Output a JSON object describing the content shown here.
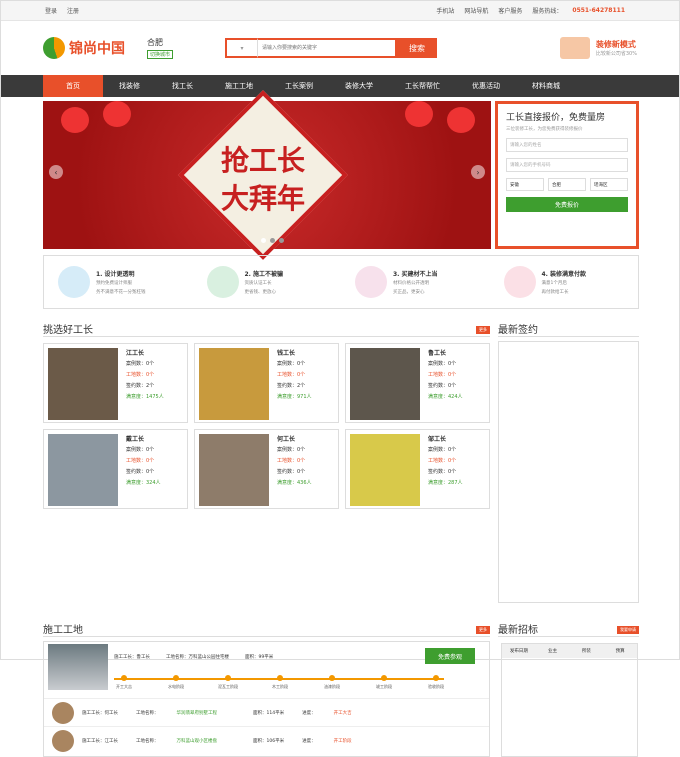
{
  "topbar": {
    "login": "登录",
    "register": "注册",
    "mobile": "手机站",
    "map": "网站导航",
    "service": "客户服务",
    "hotline_label": "服务热线：",
    "hotline": "0551-64278111"
  },
  "header": {
    "logo": "锦尚中国",
    "city": "合肥",
    "switch_city": "切换城市",
    "search_placeholder": "请输入你要搜索的关键字",
    "search_btn": "搜索",
    "promo_title": "装修新模式",
    "promo_sub": "比较新公司省30%"
  },
  "nav": [
    "首页",
    "找装修",
    "找工长",
    "施工工地",
    "工长案例",
    "装修大学",
    "工长帮帮忙",
    "优惠活动",
    "材料商城"
  ],
  "banner": {
    "line1": "抢工长",
    "line2": "大拜年"
  },
  "quote": {
    "title": "工长直接报价，免费量房",
    "sub": "三位装修工长，为您免费获得装修报价",
    "name": "请输入您的姓名",
    "phone": "请输入您的手机号码",
    "prov": "安徽",
    "city": "合肥",
    "area": "瑶海区",
    "btn": "免费报价"
  },
  "features": [
    {
      "title": "1. 设计更透明",
      "d1": "预约免费设计师服",
      "d2": "务不满意不花一分冤枉钱"
    },
    {
      "title": "2. 施工不被骗",
      "d1": "资质认证工长",
      "d2": "更省钱、更放心"
    },
    {
      "title": "3. 买建材不上当",
      "d1": "材料价格公开透明",
      "d2": "买正品，更安心"
    },
    {
      "title": "4. 装修满意付款",
      "d1": "满意1个月后",
      "d2": "再付款给工长"
    }
  ],
  "sections": {
    "good": "挑选好工长",
    "good_more": "更多",
    "latest_sign": "最新签约",
    "site": "施工工地",
    "site_more": "更多",
    "latest_bid": "最新招标",
    "bid_more": "我要申请"
  },
  "workers": [
    {
      "name": "江工长",
      "cases": "案例数：0个",
      "sites": "工地数：0个",
      "sign": "签约数：2个",
      "score": "满意度：1475人"
    },
    {
      "name": "钱工长",
      "cases": "案例数：0个",
      "sites": "工地数：0个",
      "sign": "签约数：2个",
      "score": "满意度：971人"
    },
    {
      "name": "鲁工长",
      "cases": "案例数：0个",
      "sites": "工地数：0个",
      "sign": "签约数：0个",
      "score": "满意度：424人"
    },
    {
      "name": "戴工长",
      "cases": "案例数：0个",
      "sites": "工地数：0个",
      "sign": "签约数：0个",
      "score": "满意度：324人"
    },
    {
      "name": "何工长",
      "cases": "案例数：0个",
      "sites": "工地数：0个",
      "sign": "签约数：0个",
      "score": "满意度：436人"
    },
    {
      "name": "邹工长",
      "cases": "案例数：0个",
      "sites": "工地数：0个",
      "sign": "签约数：0个",
      "score": "满意度：287人"
    }
  ],
  "site": {
    "worker": "施工工长：鲁工长",
    "name": "工地名称：万科蓝山公园住宅楼",
    "budget": "面积：99平米",
    "btn": "免费参观",
    "steps": [
      "开工大吉",
      "水电阶段",
      "泥瓦工阶段",
      "木工阶段",
      "油漆阶段",
      "竣工阶段",
      "验收阶段"
    ]
  },
  "site_rows": [
    {
      "worker": "施工工长：何工长",
      "name_label": "工地名称：",
      "name": "华润翡翠府别墅工程",
      "area": "面积：114平米",
      "status_label": "进度：",
      "status": "开工大吉"
    },
    {
      "worker": "施工工长：江工长",
      "name_label": "工地名称：",
      "name": "万科蓝山观小区楼盘",
      "area": "面积：106平米",
      "status_label": "进度：",
      "status": "开工阶段"
    }
  ],
  "bid_table": {
    "cols": [
      "发布日期",
      "业主",
      "所装",
      "预算"
    ]
  }
}
